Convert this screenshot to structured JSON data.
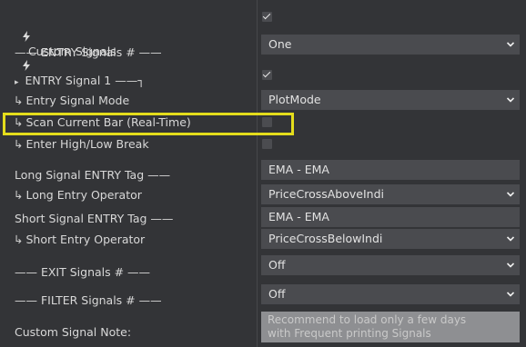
{
  "labels": {
    "custom_signals": "Custom Signals",
    "entry_signals_count": "—— ENTRY Signals # ——",
    "entry_signal_1": "ENTRY Signal 1 ——┐",
    "entry_signal_mode": "Entry Signal Mode",
    "scan_current_bar": "Scan Current Bar (Real-Time)",
    "enter_high_low_break": "Enter High/Low Break",
    "long_signal_entry_tag": "Long Signal ENTRY Tag ——",
    "long_entry_operator": "Long Entry Operator",
    "short_signal_entry_tag": "Short Signal ENTRY Tag ——",
    "short_entry_operator": "Short Entry Operator",
    "exit_signals_count": "—— EXIT Signals # ——",
    "filter_signals_count": "—— FILTER Signals # ——",
    "custom_signal_note": "Custom Signal Note:"
  },
  "sub_arrow": "↳",
  "expand_arrow": "▸",
  "values": {
    "custom_signals_enabled": true,
    "entry_signals_count": "One",
    "entry_signal_1_enabled": true,
    "entry_signal_mode": "PlotMode",
    "scan_current_bar": false,
    "enter_high_low_break": false,
    "long_signal_entry_tag": "EMA - EMA",
    "long_entry_operator": "PriceCrossAboveIndi",
    "short_signal_entry_tag": "EMA - EMA",
    "short_entry_operator": "PriceCrossBelowIndi",
    "exit_signals_count": "Off",
    "filter_signals_count": "Off",
    "custom_signal_note": "Recommend to load only a few days\nwith Frequent printing Signals"
  },
  "colors": {
    "background": "#333437",
    "field": "#4a4b4f",
    "highlight": "#e4dd1c",
    "note_field": "#8e8f92"
  }
}
